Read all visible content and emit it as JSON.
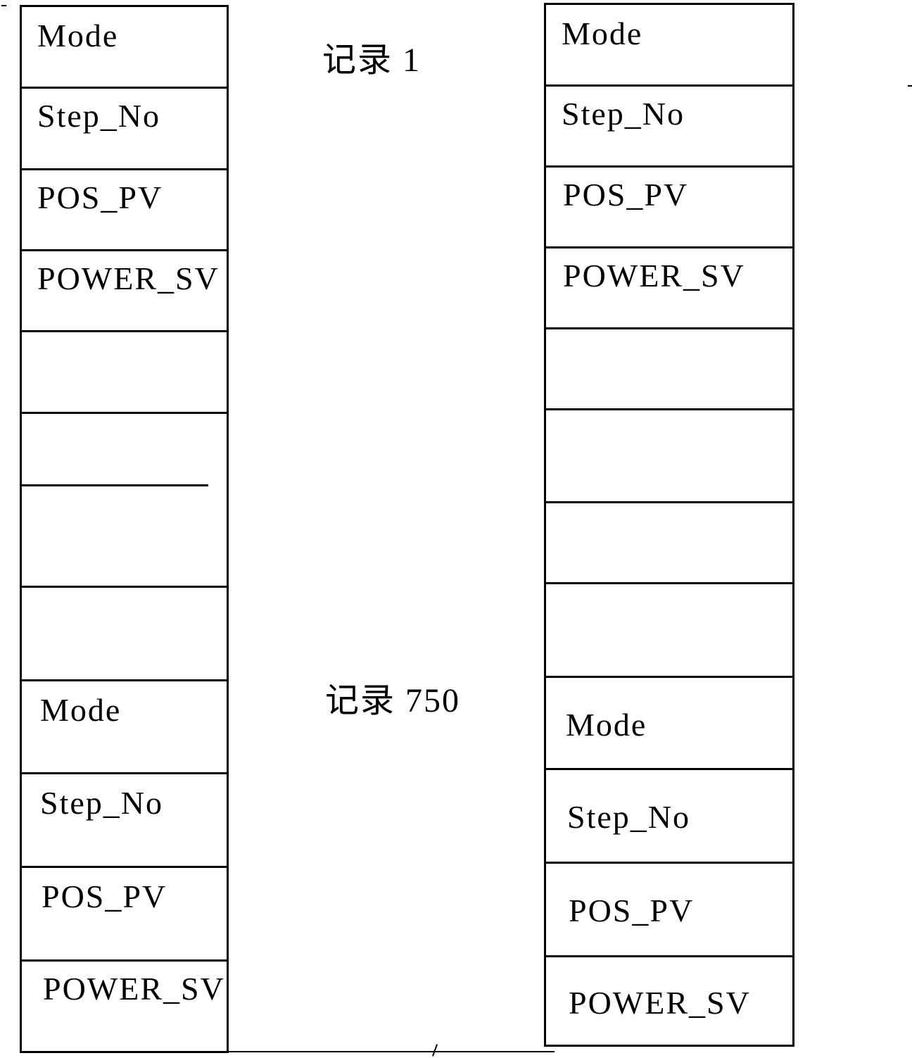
{
  "captions": {
    "record_first": "记录 1",
    "record_last": "记录 750"
  },
  "left_column": {
    "top_block": [
      "Mode",
      "Step_No",
      "POS_PV",
      "POWER_SV"
    ],
    "empty_rows": 4,
    "bottom_block": [
      "Mode",
      "Step_No",
      "POS_PV",
      "POWER_SV"
    ]
  },
  "right_column": {
    "top_block": [
      "Mode",
      "Step_No",
      "POS_PV",
      "POWER_SV"
    ],
    "empty_rows": 4,
    "bottom_block": [
      "Mode",
      "Step_No",
      "POS_PV",
      "POWER_SV"
    ]
  }
}
